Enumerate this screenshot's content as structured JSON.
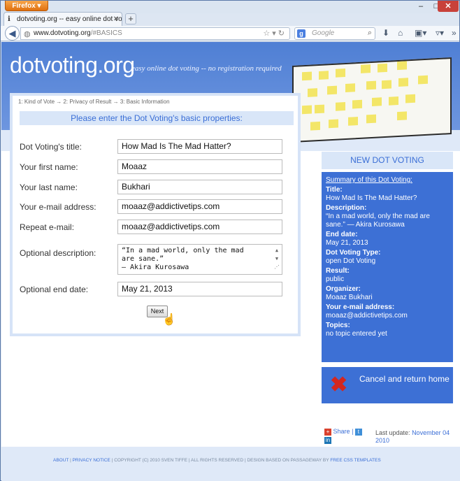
{
  "browser": {
    "menu_label": "Firefox",
    "tab_title": "dotvoting.org -- easy online dot voting -...",
    "url_domain": "www.dotvoting.org",
    "url_path": "/#BASICS",
    "search_placeholder": "Google",
    "search_engine_letter": "g"
  },
  "header": {
    "logo": "dotvoting.org",
    "tagline": "easy online dot voting -- no registration required"
  },
  "form": {
    "breadcrumb": "1: Kind of Vote → 2: Privacy of Result → 3: Basic Information",
    "heading": "Please enter the Dot Voting's basic properties:",
    "labels": {
      "title": "Dot Voting's title:",
      "first_name": "Your first name:",
      "last_name": "Your last name:",
      "email": "Your e-mail address:",
      "repeat_email": "Repeat e-mail:",
      "description": "Optional description:",
      "end_date": "Optional end date:"
    },
    "values": {
      "title": "How Mad Is The Mad Hatter?",
      "first_name": "Moaaz",
      "last_name": "Bukhari",
      "email": "moaaz@addictivetips.com",
      "repeat_email": "moaaz@addictivetips.com",
      "description_line1": "“In a mad world, only the mad",
      "description_line2": "are sane.”",
      "description_line3": "— Akira Kurosawa",
      "end_date": "May 21, 2013"
    },
    "next_label": "Next"
  },
  "sidebar": {
    "heading": "NEW DOT VOTING",
    "summary_title": "Summary of this Dot Voting:",
    "items": [
      {
        "key": "Title:",
        "value": "How Mad Is The Mad Hatter?"
      },
      {
        "key": "Description:",
        "value": "“In a mad world, only the mad are sane.” — Akira Kurosawa"
      },
      {
        "key": "End date:",
        "value": "May 21, 2013"
      },
      {
        "key": "Dot Voting Type:",
        "value": "open Dot Voting"
      },
      {
        "key": "Result:",
        "value": "public"
      },
      {
        "key": "Organizer:",
        "value": "Moaaz Bukhari"
      },
      {
        "key": "Your e-mail address:",
        "value": "moaaz@addictivetips.com"
      },
      {
        "key": "Topics:",
        "value": "no topic entered yet"
      }
    ],
    "cancel_label": "Cancel and return home"
  },
  "social": {
    "share_label": "Share",
    "separator": "|",
    "last_update_label": "Last update:",
    "last_update_value": "November 04 2010"
  },
  "footer": {
    "about": "ABOUT",
    "privacy": "PRIVACY NOTICE",
    "copyright": "| COPYRIGHT (C) 2010 SVEN TIFFE | ALL RIGHTS RESERVED | DESIGN BASED ON PASSAGEWAY BY",
    "templates": "FREE CSS TEMPLATES"
  },
  "colors": {
    "accent": "#3a6ed6",
    "sidebar_bg": "#3d70d5",
    "header_bg": "#4f7fd4",
    "cancel_icon": "#d4271f"
  }
}
